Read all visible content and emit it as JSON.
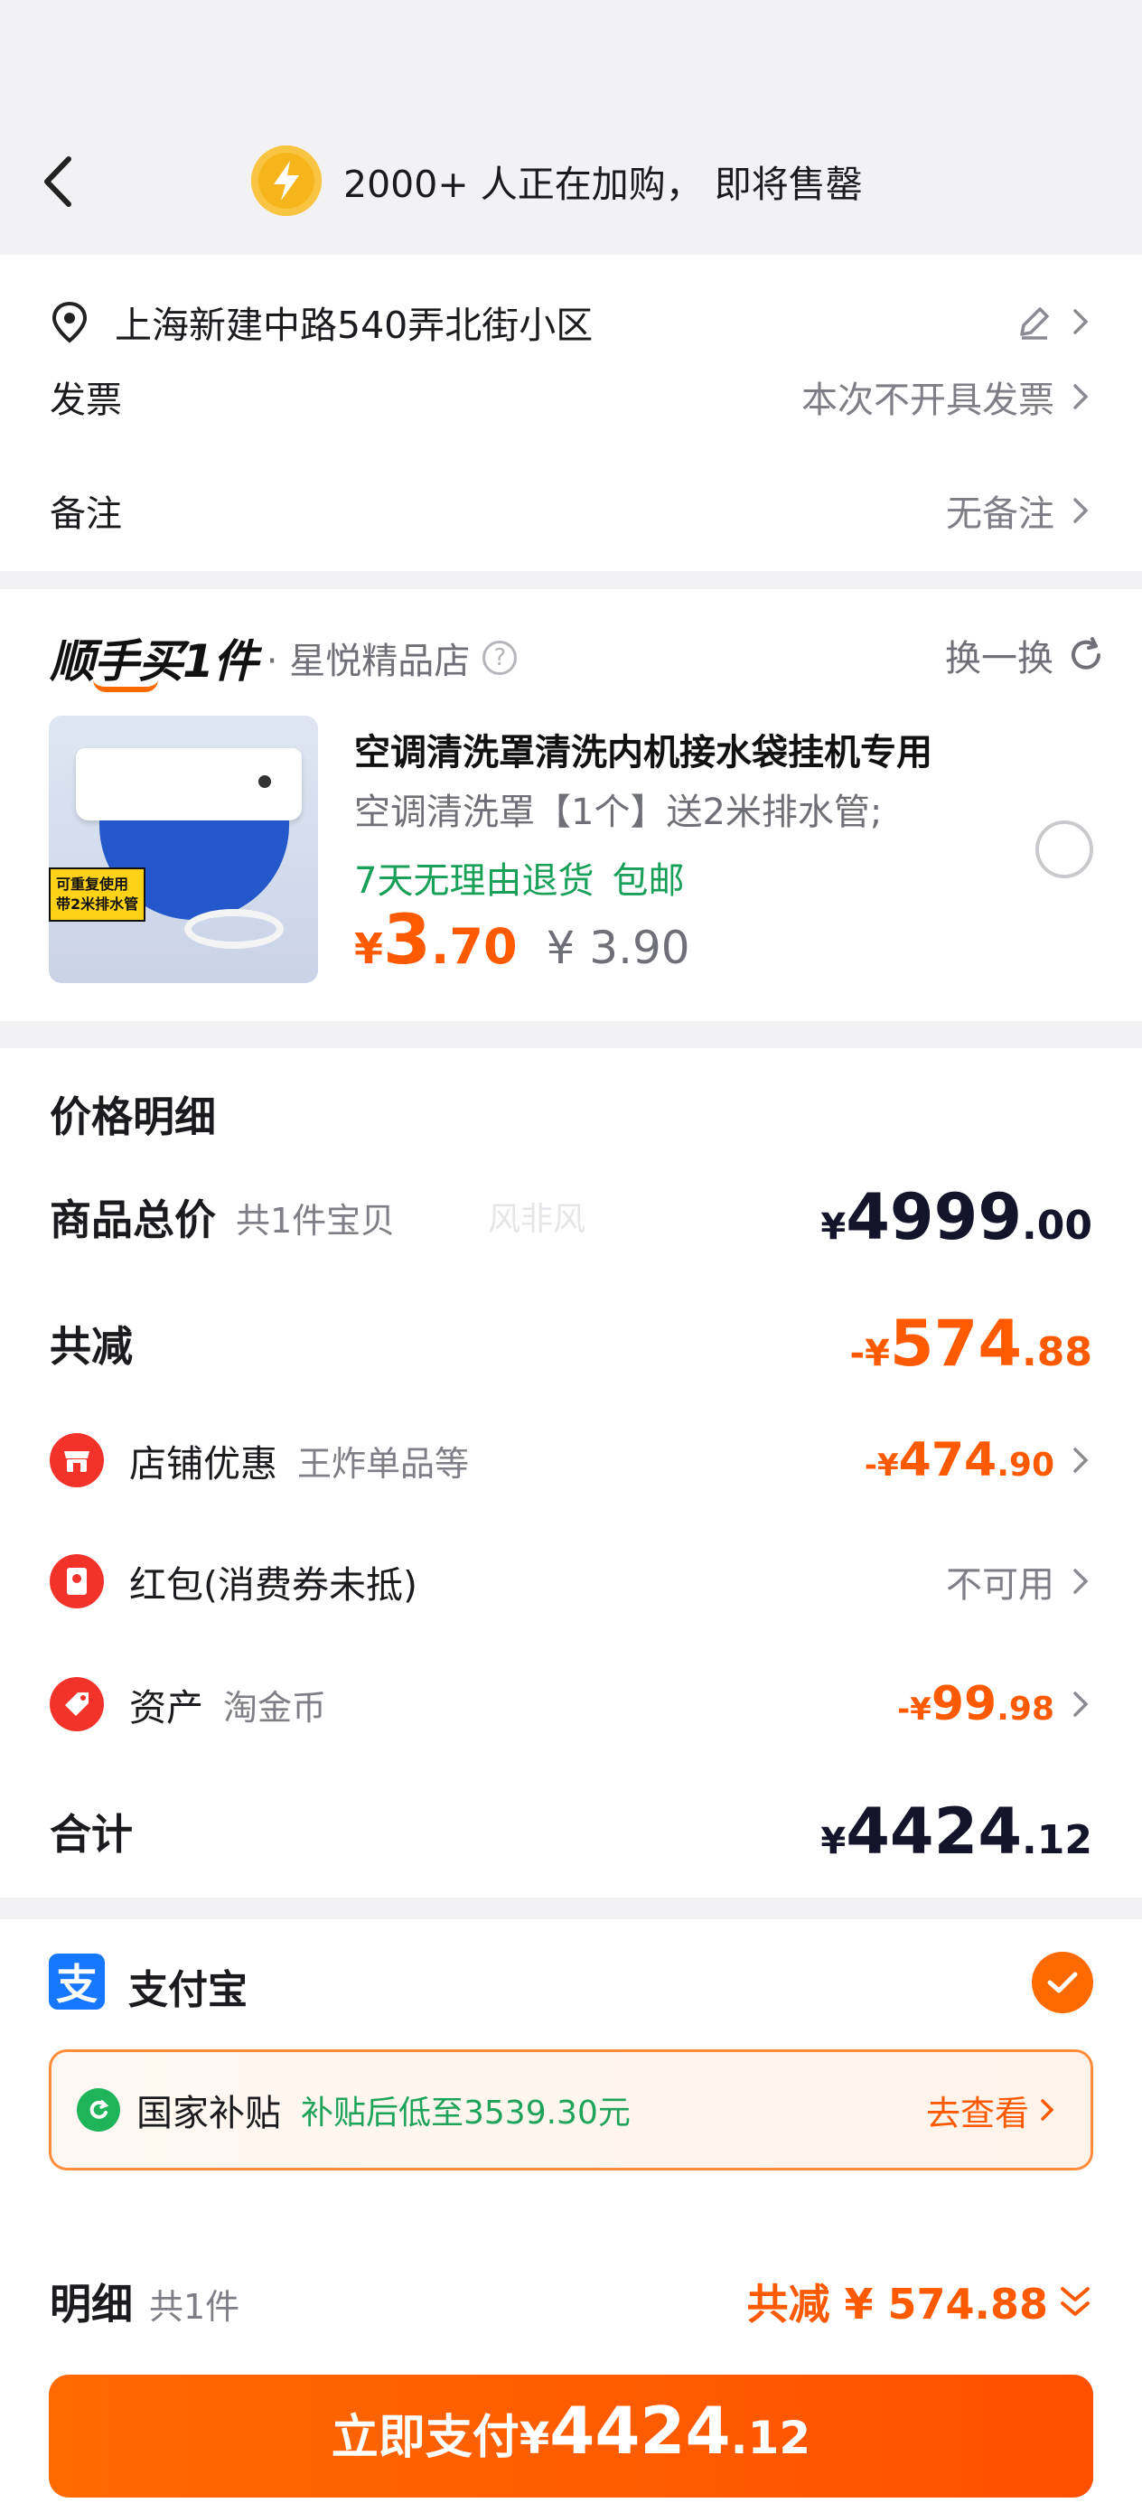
{
  "header": {
    "promo_text": "2000+ 人正在加购， 即将售罄"
  },
  "address": {
    "text": "上海新建中路540弄北街小区",
    "invoice_label": "发票",
    "invoice_value": "本次不开具发票",
    "remark_label": "备注",
    "remark_value": "无备注"
  },
  "addon": {
    "brand": "顺手买1件",
    "shop": "· 星悦精品店",
    "swap_label": "换一换",
    "product": {
      "title": "空调清洗罩清洗内机接水袋挂机专用",
      "spec": "空调清洗罩【1个】送2米排水管;",
      "tag1": "7天无理由退货",
      "tag2": "包邮",
      "price_symbol": "¥",
      "price_int": "3",
      "price_dec": ".70",
      "original_price": "¥ 3.90",
      "image_tag_line1": "可重复使用",
      "image_tag_line2": "带2米排水管"
    }
  },
  "price_detail": {
    "title": "价格明细",
    "watermark": "风非风",
    "total_label": "商品总价",
    "total_note": "共1件宝贝",
    "total": {
      "y": "¥",
      "i": "4999",
      "d": ".00"
    },
    "discount_label": "共减",
    "discount": {
      "y": "-¥",
      "i": "574",
      "d": ".88"
    },
    "shop_coupon_label": "店铺优惠",
    "shop_coupon_note": "王炸单品等",
    "shop_coupon": {
      "y": "-¥",
      "i": "474",
      "d": ".90"
    },
    "redpacket_label": "红包(消费券未抵)",
    "redpacket_value": "不可用",
    "asset_label": "资产",
    "asset_note": "淘金币",
    "asset": {
      "y": "-¥",
      "i": "99",
      "d": ".98"
    },
    "sum_label": "合计",
    "sum": {
      "y": "¥",
      "i": "4424",
      "d": ".12"
    }
  },
  "payment": {
    "alipay_glyph": "支",
    "method": "支付宝",
    "subsidy_title": "国家补贴",
    "subsidy_desc": "补贴后低至3539.30元",
    "subsidy_link": "去查看"
  },
  "footer": {
    "detail_label": "明细",
    "detail_count": "共1件",
    "discount_text": "共减 ¥ 574.88",
    "pay_label": "立即支付",
    "pay_y": "¥",
    "pay_i": "4424",
    "pay_d": ".12"
  },
  "colors": {
    "accent": "#ff5a00",
    "green": "#18a058",
    "alipay_blue": "#1677ff",
    "icon_red": "#f3322a"
  }
}
